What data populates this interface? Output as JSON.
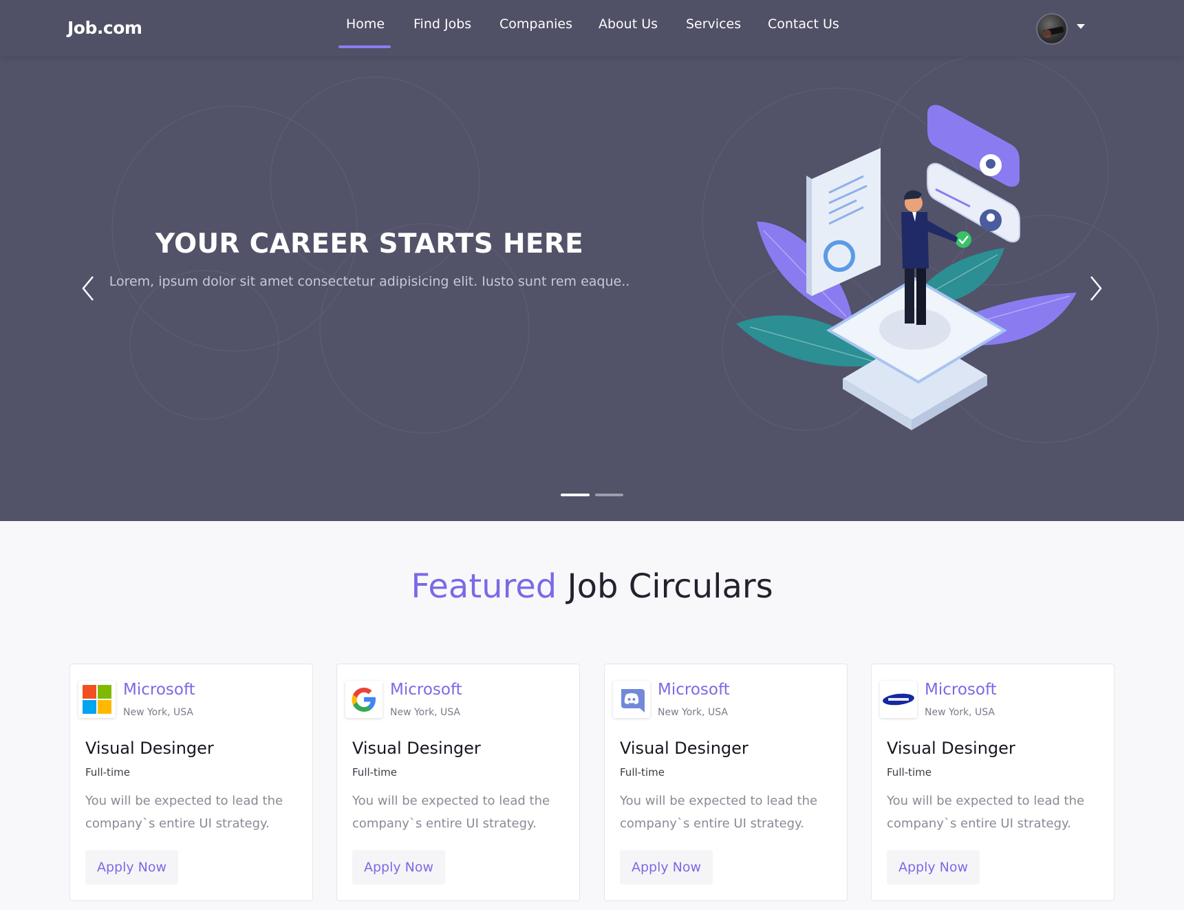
{
  "header": {
    "logo": "Job.com",
    "nav": [
      "Home",
      "Find Jobs",
      "Companies",
      "About Us",
      "Services",
      "Contact Us"
    ],
    "active_index": 0,
    "accent": "#8d7cf4"
  },
  "hero": {
    "title": "YOUR CAREER STARTS HERE",
    "subtitle": "Lorem, ipsum dolor sit amet consectetur adipisicing elit. Iusto sunt rem eaque..",
    "slides": 2,
    "active_slide": 0,
    "background": "#525269"
  },
  "featured": {
    "title_accent": "Featured",
    "title_rest": "Job Circulars",
    "accent": "#7a6ae6"
  },
  "jobs": [
    {
      "logo_icon": "microsoft-logo-icon",
      "company": "Microsoft",
      "location": "New York, USA",
      "title": "Visual Desinger",
      "type": "Full-time",
      "description": "You will be expected to lead the company`s entire UI strategy.",
      "button": "Apply Now"
    },
    {
      "logo_icon": "google-logo-icon",
      "company": "Microsoft",
      "location": "New York, USA",
      "title": "Visual Desinger",
      "type": "Full-time",
      "description": "You will be expected to lead the company`s entire UI strategy.",
      "button": "Apply Now"
    },
    {
      "logo_icon": "discord-logo-icon",
      "company": "Microsoft",
      "location": "New York, USA",
      "title": "Visual Desinger",
      "type": "Full-time",
      "description": "You will be expected to lead the company`s entire UI strategy.",
      "button": "Apply Now"
    },
    {
      "logo_icon": "samsung-logo-icon",
      "company": "Microsoft",
      "location": "New York, USA",
      "title": "Visual Desinger",
      "type": "Full-time",
      "description": "You will be expected to lead the company`s entire UI strategy.",
      "button": "Apply Now"
    }
  ]
}
